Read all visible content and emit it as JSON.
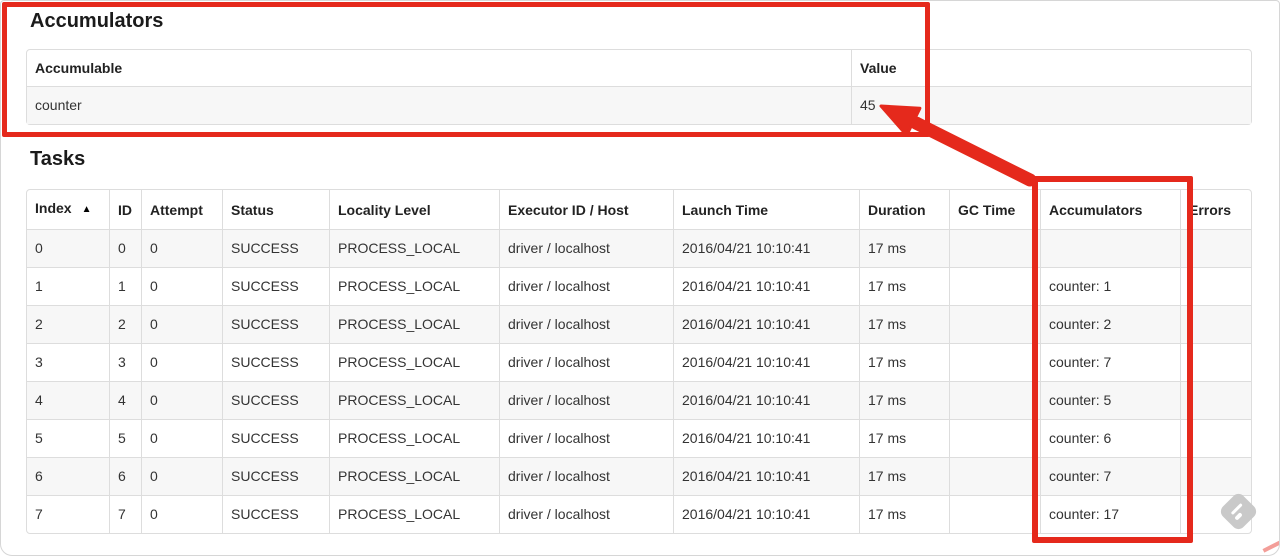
{
  "window": {
    "background": "#ffffff",
    "frame_border": "#d6d6d6"
  },
  "accumulators_section": {
    "title": "Accumulators",
    "table": {
      "headers": [
        "Accumulable",
        "Value"
      ],
      "rows": [
        [
          "counter",
          "45"
        ]
      ]
    }
  },
  "tasks_section": {
    "title": "Tasks",
    "table": {
      "headers": [
        "Index",
        "ID",
        "Attempt",
        "Status",
        "Locality Level",
        "Executor ID / Host",
        "Launch Time",
        "Duration",
        "GC Time",
        "Accumulators",
        "Errors"
      ],
      "sort": {
        "column": 0,
        "icon": "▲",
        "direction": "ascending"
      },
      "rows": [
        [
          "0",
          "0",
          "0",
          "SUCCESS",
          "PROCESS_LOCAL",
          "driver / localhost",
          "2016/04/21 10:10:41",
          "17 ms",
          "",
          "",
          ""
        ],
        [
          "1",
          "1",
          "0",
          "SUCCESS",
          "PROCESS_LOCAL",
          "driver / localhost",
          "2016/04/21 10:10:41",
          "17 ms",
          "",
          "counter: 1",
          ""
        ],
        [
          "2",
          "2",
          "0",
          "SUCCESS",
          "PROCESS_LOCAL",
          "driver / localhost",
          "2016/04/21 10:10:41",
          "17 ms",
          "",
          "counter: 2",
          ""
        ],
        [
          "3",
          "3",
          "0",
          "SUCCESS",
          "PROCESS_LOCAL",
          "driver / localhost",
          "2016/04/21 10:10:41",
          "17 ms",
          "",
          "counter: 7",
          ""
        ],
        [
          "4",
          "4",
          "0",
          "SUCCESS",
          "PROCESS_LOCAL",
          "driver / localhost",
          "2016/04/21 10:10:41",
          "17 ms",
          "",
          "counter: 5",
          ""
        ],
        [
          "5",
          "5",
          "0",
          "SUCCESS",
          "PROCESS_LOCAL",
          "driver / localhost",
          "2016/04/21 10:10:41",
          "17 ms",
          "",
          "counter: 6",
          ""
        ],
        [
          "6",
          "6",
          "0",
          "SUCCESS",
          "PROCESS_LOCAL",
          "driver / localhost",
          "2016/04/21 10:10:41",
          "17 ms",
          "",
          "counter: 7",
          ""
        ],
        [
          "7",
          "7",
          "0",
          "SUCCESS",
          "PROCESS_LOCAL",
          "driver / localhost",
          "2016/04/21 10:10:41",
          "17 ms",
          "",
          "counter: 17",
          ""
        ]
      ]
    }
  },
  "annotations": {
    "highlight_color": "#e5291c",
    "summary_box_label": "highlight around Accumulators summary",
    "column_box_label": "highlight around Accumulators task column",
    "arrow_label": "arrow from Accumulators column to value 45"
  },
  "watermark": {
    "name": "stamp-watermark",
    "color": "#c9c9c9"
  }
}
